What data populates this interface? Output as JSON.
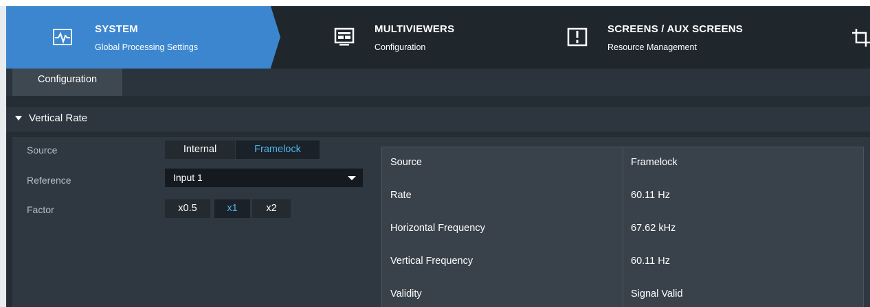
{
  "nav": {
    "items": [
      {
        "title": "SYSTEM",
        "subtitle": "Global Processing Settings",
        "icon": "waveform-monitor-icon",
        "active": true
      },
      {
        "title": "MULTIVIEWERS",
        "subtitle": "Configuration",
        "icon": "multiviewer-display-icon",
        "active": false
      },
      {
        "title": "SCREENS / AUX SCREENS",
        "subtitle": "Resource Management",
        "icon": "screen-split-icon",
        "active": false
      }
    ]
  },
  "tabs": [
    "Configuration"
  ],
  "section": {
    "title": "Vertical Rate"
  },
  "form": {
    "source_label": "Source",
    "source_options": [
      "Internal",
      "Framelock"
    ],
    "source_selected": "Framelock",
    "reference_label": "Reference",
    "reference_value": "Input 1",
    "factor_label": "Factor",
    "factor_options": [
      "x0.5",
      "x1",
      "x2"
    ],
    "factor_selected": "x1"
  },
  "status": [
    {
      "key": "Source",
      "value": "Framelock"
    },
    {
      "key": "Rate",
      "value": "60.11 Hz"
    },
    {
      "key": "Horizontal Frequency",
      "value": "67.62 kHz"
    },
    {
      "key": "Vertical Frequency",
      "value": "60.11 Hz"
    },
    {
      "key": "Validity",
      "value": "Signal Valid"
    }
  ],
  "colors": {
    "accent": "#3b86cf",
    "selected_text": "#4fb3e8",
    "background": "#252d34"
  }
}
